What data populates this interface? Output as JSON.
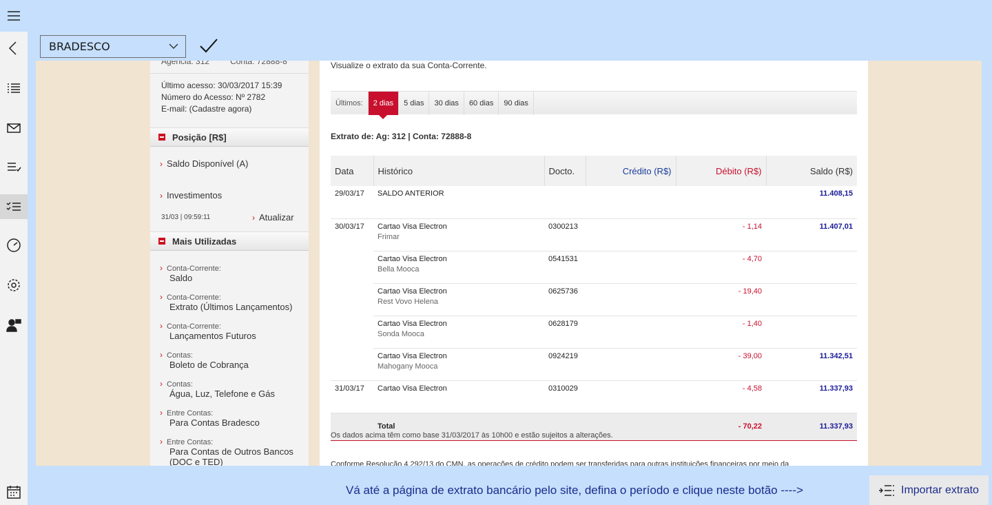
{
  "toolbar": {
    "bank": "BRADESCO"
  },
  "sidebar": {
    "agencia_line": "Agência: 312",
    "conta_line": "Conta: 72888-8",
    "last_access": "Último acesso: 30/03/2017 15:39",
    "access_number": "Número do Acesso: Nº 2782",
    "email": "E-mail: (Cadastre agora)",
    "posicao_title": "Posição [R$]",
    "saldo_disponivel": "Saldo Disponível (A)",
    "investimentos": "Investimentos",
    "timestamp": "31/03 | 09:59:11",
    "atualizar": "Atualizar",
    "mais_title": "Mais Utilizadas",
    "items": [
      {
        "cat": "Conta-Corrente:",
        "label": "Saldo"
      },
      {
        "cat": "Conta-Corrente:",
        "label": "Extrato (Últimos Lançamentos)"
      },
      {
        "cat": "Conta-Corrente:",
        "label": "Lançamentos Futuros"
      },
      {
        "cat": "Contas:",
        "label": "Boleto de Cobrança"
      },
      {
        "cat": "Contas:",
        "label": "Água, Luz, Telefone e Gás"
      },
      {
        "cat": "Entre Contas:",
        "label": "Para Contas Bradesco"
      },
      {
        "cat": "Entre Contas:",
        "label": "Para Contas de Outros Bancos (DOC e TED)"
      }
    ]
  },
  "content": {
    "intro": "Visualize o extrato da sua Conta-Corrente.",
    "tabs_label": "Últimos:",
    "tabs": [
      "2 dias",
      "5 dias",
      "30 dias",
      "60 dias",
      "90 dias"
    ],
    "selected_tab": "2 dias",
    "account_title": "Extrato de: Ag: 312 | Conta: 72888-8",
    "headers": {
      "data": "Data",
      "historico": "Histórico",
      "docto": "Docto.",
      "credito": "Crédito (R$)",
      "debito": "Débito (R$)",
      "saldo": "Saldo (R$)"
    },
    "rows": [
      {
        "data": "29/03/17",
        "hist": "SALDO ANTERIOR",
        "sub": "",
        "docto": "",
        "credito": "",
        "debito": "",
        "saldo": "11.408,15"
      },
      {
        "data": "30/03/17",
        "hist": "Cartao Visa Electron",
        "sub": "Frimar",
        "docto": "0300213",
        "credito": "",
        "debito": "- 1,14",
        "saldo": "11.407,01"
      },
      {
        "data": "",
        "hist": "Cartao Visa Electron",
        "sub": "Bella Mooca",
        "docto": "0541531",
        "credito": "",
        "debito": "- 4,70",
        "saldo": ""
      },
      {
        "data": "",
        "hist": "Cartao Visa Electron",
        "sub": "Rest Vovo Helena",
        "docto": "0625736",
        "credito": "",
        "debito": "- 19,40",
        "saldo": ""
      },
      {
        "data": "",
        "hist": "Cartao Visa Electron",
        "sub": "Sonda Mooca",
        "docto": "0628179",
        "credito": "",
        "debito": "- 1,40",
        "saldo": ""
      },
      {
        "data": "",
        "hist": "Cartao Visa Electron",
        "sub": "Mahogany Mooca",
        "docto": "0924219",
        "credito": "",
        "debito": "- 39,00",
        "saldo": "11.342,51"
      },
      {
        "data": "31/03/17",
        "hist": "Cartao Visa Electron",
        "sub": "",
        "docto": "0310029",
        "credito": "",
        "debito": "- 4,58",
        "saldo": "11.337,93"
      }
    ],
    "total": {
      "label": "Total",
      "debito": "- 70,22",
      "saldo": "11.337,93"
    },
    "note": "Os dados acima têm como base 31/03/2017 às 10h00 e estão sujeitos a alterações.",
    "resolution": "Conforme Resolução 4.292/13 do CMN, as operações de crédito podem ser transferidas para outras instituições financeiras por meio da"
  },
  "footer": {
    "hint": "Vá até a página de extrato bancário pelo site, defina o período e clique neste botão ---->",
    "import_label": "Importar extrato"
  }
}
